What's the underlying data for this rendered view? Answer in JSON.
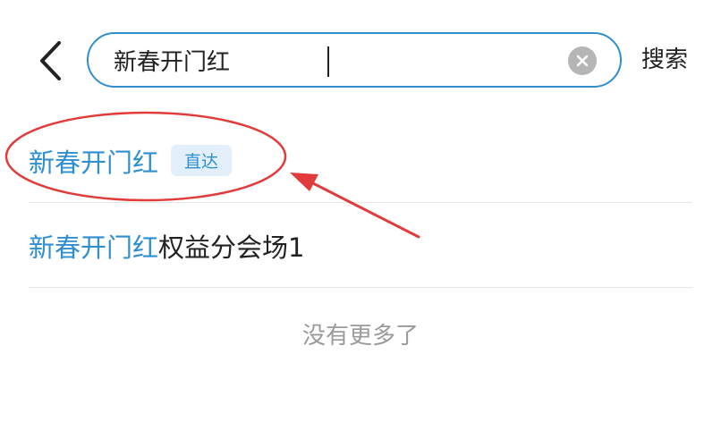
{
  "header": {
    "back_icon": "chevron-left-icon",
    "search": {
      "value": "新春开门红",
      "clear_icon": "clear-circle-icon"
    },
    "search_button_label": "搜索"
  },
  "results": [
    {
      "highlight": "新春开门红",
      "rest": "",
      "badge": "直达"
    },
    {
      "highlight": "新春开门红",
      "rest": "权益分会场1"
    }
  ],
  "footer": {
    "no_more_text": "没有更多了"
  },
  "annotation": {
    "color": "#e23b3b",
    "ellipse_target": "result-row-1",
    "arrow_icon": "red-arrow"
  },
  "colors": {
    "accent": "#2f8fd0",
    "badge_bg": "#e3f0fb",
    "text": "#222222",
    "muted": "#9a9a9a"
  }
}
